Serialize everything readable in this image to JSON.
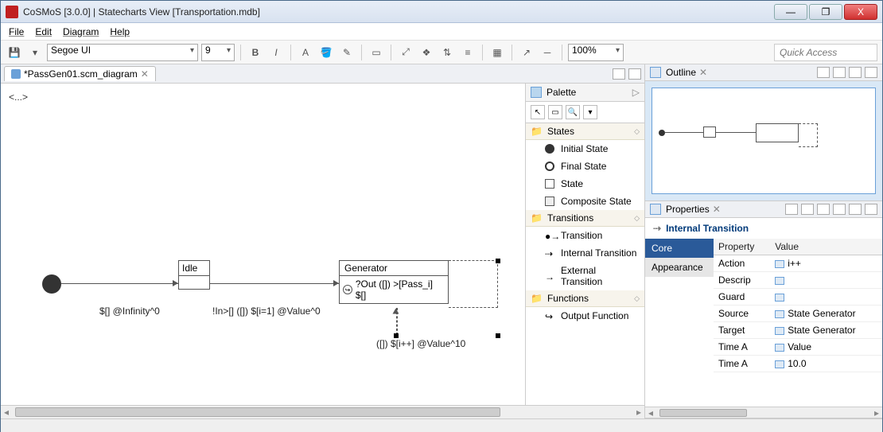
{
  "title": "CoSMoS [3.0.0] | Statecharts View [Transportation.mdb]",
  "win": {
    "min": "—",
    "max": "❐",
    "close": "X"
  },
  "menu": {
    "file": "File",
    "edit": "Edit",
    "diagram": "Diagram",
    "help": "Help"
  },
  "toolbar": {
    "font": "Segoe UI",
    "size": "9",
    "bold": "B",
    "italic": "I",
    "fontcolor": "A",
    "zoom": "100%",
    "quick": "Quick Access"
  },
  "editor": {
    "tab": "*PassGen01.scm_diagram",
    "crumbs": "<...>",
    "idle": "Idle",
    "generator": "Generator",
    "outexpr": "?Out ([]) >[Pass_i] $[]",
    "trans1": "$[] @Infinity^0",
    "trans2": "!In>[] ([]) $[i=1] @Value^0",
    "trans3": "([]) $[i++] @Value^10"
  },
  "palette": {
    "title": "Palette",
    "cat_states": "States",
    "initial": "Initial State",
    "final": "Final State",
    "state": "State",
    "composite": "Composite State",
    "cat_transitions": "Transitions",
    "transition": "Transition",
    "internal": "Internal Transition",
    "external": "External Transition",
    "cat_functions": "Functions",
    "output": "Output Function"
  },
  "outline": {
    "title": "Outline"
  },
  "props": {
    "title": "Properties",
    "heading": "Internal Transition",
    "cat_core": "Core",
    "cat_appearance": "Appearance",
    "col_prop": "Property",
    "col_val": "Value",
    "rows": [
      {
        "p": "Action",
        "v": "i++"
      },
      {
        "p": "Descrip",
        "v": ""
      },
      {
        "p": "Guard",
        "v": ""
      },
      {
        "p": "Source",
        "v": "State Generator"
      },
      {
        "p": "Target",
        "v": "State Generator"
      },
      {
        "p": "Time A",
        "v": "Value"
      },
      {
        "p": "Time A",
        "v": "10.0"
      }
    ]
  }
}
